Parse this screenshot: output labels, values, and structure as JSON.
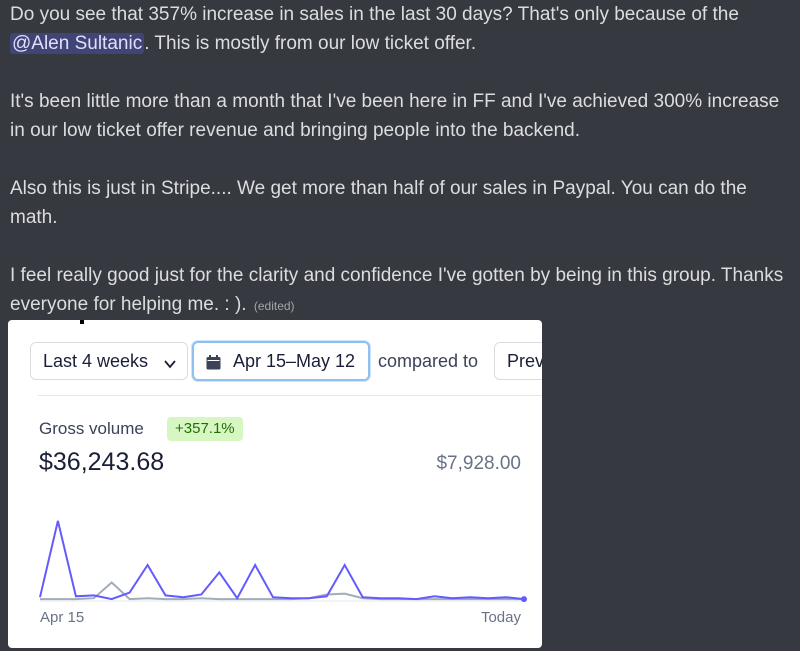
{
  "message": {
    "p1_before": "Do you see that 357% increase in sales in the last 30 days? That's only because of the ",
    "mention": "@Alen Sultanic",
    "p1_after": ". This is mostly from our low ticket offer.",
    "p2": "It's been little more than a month that I've been here in FF and I've achieved 300% increase in our low ticket offer revenue and bringing people into the backend.",
    "p3": "Also this is just in Stripe.... We get more than half of our sales in Paypal. You can do the math.",
    "p4": "I feel really good just for the clarity and confidence I've gotten by being in this group. Thanks everyone for helping me. : ).",
    "edited": "(edited)"
  },
  "stripe": {
    "period_label": "Last 4 weeks",
    "date_range": "Apr 15–May 12",
    "compared_to": "compared to",
    "previous_label": "Prev",
    "metric_label": "Gross volume",
    "change_badge": "+357.1%",
    "current_value": "$36,243.68",
    "previous_value": "$7,928.00",
    "axis_start": "Apr 15",
    "axis_end": "Today"
  },
  "colors": {
    "discord_bg": "#36393f",
    "current_series": "#635bff",
    "previous_series": "#a3acb9",
    "badge_bg": "#d7f7c2",
    "badge_text": "#217005"
  },
  "chart_data": {
    "type": "line",
    "x": [
      "Apr 15",
      "",
      "",
      "",
      "",
      "",
      "",
      "",
      "",
      "",
      "",
      "",
      "",
      "",
      "",
      "",
      "",
      "",
      "",
      "",
      "",
      "",
      "",
      "",
      "",
      "",
      "",
      "Today"
    ],
    "xlabel": "",
    "ylabel": "",
    "ylim": [
      0,
      10
    ],
    "grid": false,
    "series": [
      {
        "values": [
          0.3,
          8.6,
          0.4,
          0.5,
          0.1,
          0.8,
          3.8,
          0.5,
          0.3,
          0.6,
          3.0,
          0.2,
          3.8,
          0.3,
          0.2,
          0.2,
          0.4,
          3.8,
          0.3,
          0.2,
          0.2,
          0.1,
          0.4,
          0.2,
          0.3,
          0.2,
          0.3,
          0.1
        ],
        "color": "#635bff"
      },
      {
        "values": [
          0.1,
          0.1,
          0.1,
          0.2,
          1.9,
          0.1,
          0.2,
          0.1,
          0.1,
          0.2,
          0.1,
          0.1,
          0.1,
          0.1,
          0.1,
          0.2,
          0.6,
          0.7,
          0.2,
          0.1,
          0.1,
          0.1,
          0.1,
          0.1,
          0.1,
          0.1,
          0.1,
          0.1
        ],
        "color": "#a3acb9"
      }
    ]
  }
}
